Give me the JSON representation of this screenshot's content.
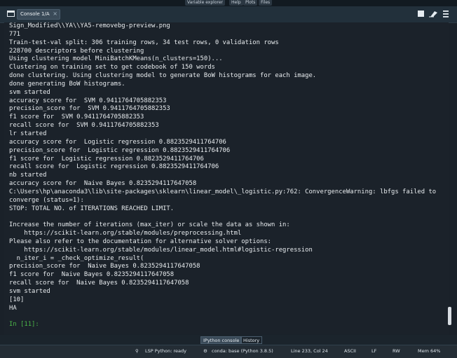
{
  "top_tabs": [
    "Variable explorer",
    "Help",
    "Plots",
    "Files"
  ],
  "console_tab": {
    "label": "Console 1/A",
    "close": "×"
  },
  "toolbar_icons": [
    "stop-kernel-icon",
    "clear-console-icon",
    "options-menu-icon"
  ],
  "output_lines": [
    "Sign_Modified\\\\YA\\\\YA5-removebg-preview.png",
    "771",
    "Train-test-val split: 306 training rows, 34 test rows, 0 validation rows",
    "228700 descriptors before clustering",
    "Using clustering model MiniBatchKMeans(n_clusters=150)...",
    "Clustering on training set to get codebook of 150 words",
    "done clustering. Using clustering model to generate BoW histograms for each image.",
    "done generating BoW histograms.",
    "svm started",
    "accuracy score for  SVM 0.9411764705882353",
    "precision_score for  SVM 0.9411764705882353",
    "f1 score for  SVM 0.9411764705882353",
    "recall score for  SVM 0.9411764705882353",
    "lr started",
    "accuracy score for  Logistic regression 0.8823529411764706",
    "precision_score for  Logistic regression 0.8823529411764706",
    "f1 score for  Logistic regression 0.8823529411764706",
    "recall score for  Logistic regression 0.8823529411764706",
    "nb started",
    "accuracy score for  Naive Bayes 0.8235294117647058",
    "C:\\Users\\hp\\anaconda3\\lib\\site-packages\\sklearn\\linear_model\\_logistic.py:762: ConvergenceWarning: lbfgs failed to",
    "converge (status=1):",
    "STOP: TOTAL NO. of ITERATIONS REACHED LIMIT.",
    "",
    "Increase the number of iterations (max_iter) or scale the data as shown in:",
    "    https://scikit-learn.org/stable/modules/preprocessing.html",
    "Please also refer to the documentation for alternative solver options:",
    "    https://scikit-learn.org/stable/modules/linear_model.html#logistic-regression",
    "  n_iter_i = _check_optimize_result(",
    "precision_score for  Naive Bayes 0.8235294117647058",
    "f1 score for  Naive Bayes 0.8235294117647058",
    "recall score for  Naive Bayes 0.8235294117647058",
    "svm started",
    "[10]",
    "HA",
    ""
  ],
  "prompt": "In [11]:",
  "bottom_tabs": [
    "IPython console",
    "History"
  ],
  "status": {
    "lsp": "LSP Python: ready",
    "conda": "conda: base (Python 3.8.5)",
    "position": "Line 233, Col 24",
    "encoding": "ASCII",
    "eol": "LF",
    "permissions": "RW",
    "memory": "Mem 64%"
  },
  "colors": {
    "background": "#1b222a",
    "prompt": "#4cb648",
    "text": "#e8ecef"
  }
}
